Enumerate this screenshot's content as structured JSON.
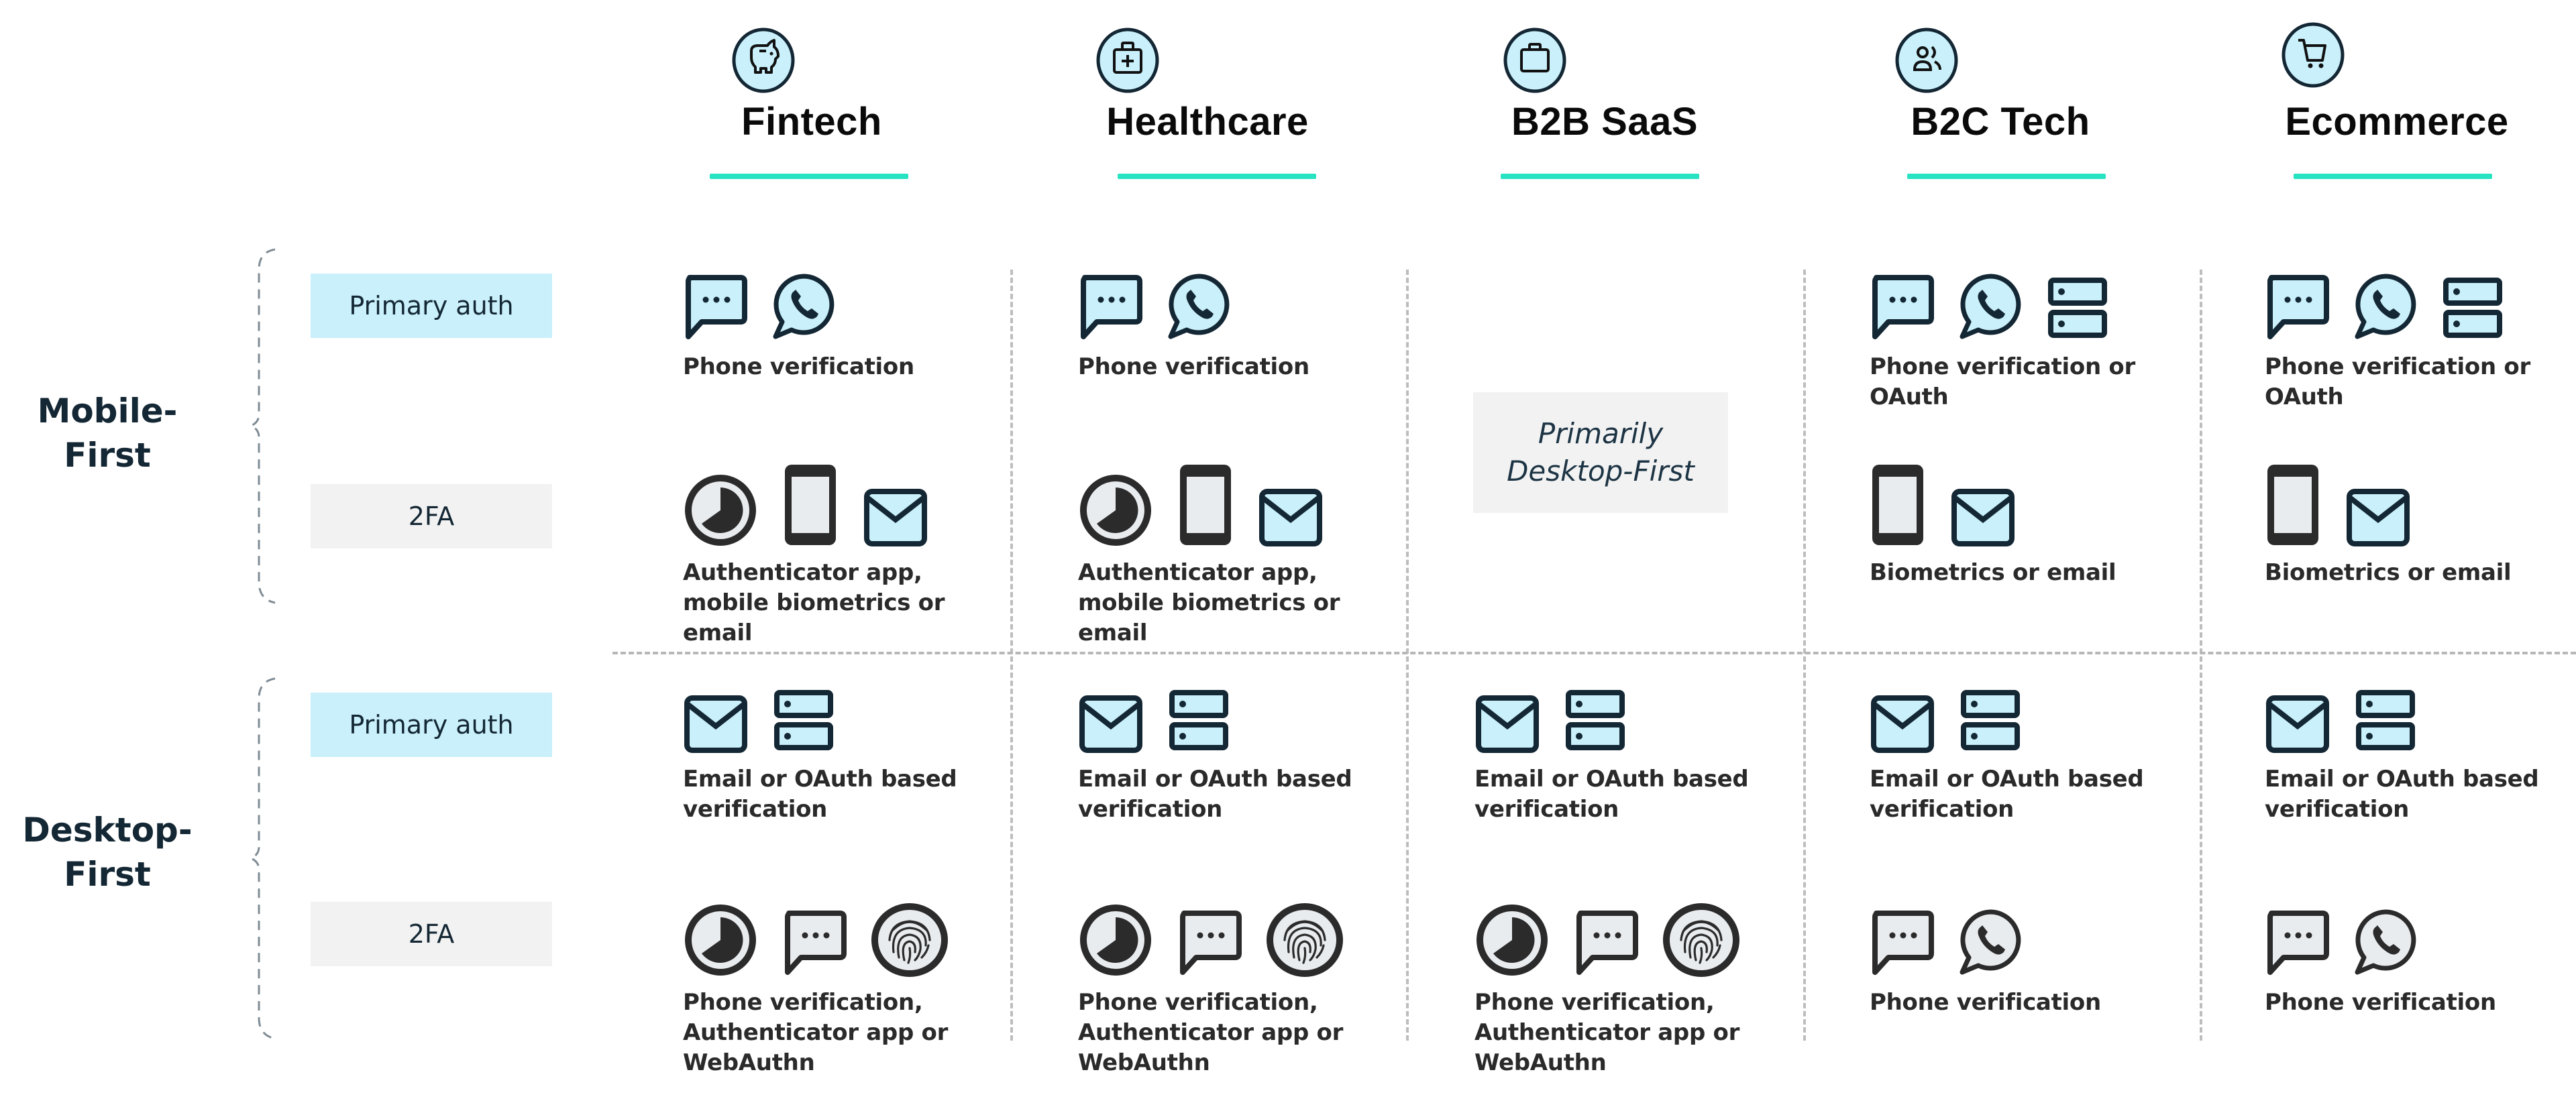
{
  "colors": {
    "accent_underline": "#27e3c2",
    "icon_fill_blue": "#c9f0fb",
    "icon_fill_gray": "#e9ecef",
    "icon_stroke_dark": "#142734",
    "primary_label_bg": "#c9f0fb",
    "twofa_label_bg": "#f2f2f2"
  },
  "columns": [
    {
      "title": "Fintech",
      "icon": "piggy-bank-icon"
    },
    {
      "title": "Healthcare",
      "icon": "medical-kit-icon"
    },
    {
      "title": "B2B SaaS",
      "icon": "briefcase-icon"
    },
    {
      "title": "B2C Tech",
      "icon": "users-icon"
    },
    {
      "title": "Ecommerce",
      "icon": "shopping-cart-icon"
    }
  ],
  "groups": [
    {
      "label_line1": "Mobile-",
      "label_line2": "First",
      "rows": [
        {
          "label": "Primary auth",
          "kind": "primary"
        },
        {
          "label": "2FA",
          "kind": "twofa"
        }
      ]
    },
    {
      "label_line1": "Desktop-",
      "label_line2": "First",
      "rows": [
        {
          "label": "Primary auth",
          "kind": "primary"
        },
        {
          "label": "2FA",
          "kind": "twofa"
        }
      ]
    }
  ],
  "b2b_mobile_note": {
    "line1": "Primarily",
    "line2": "Desktop-First"
  },
  "cells": {
    "mobile_primary": [
      {
        "text": "Phone verification",
        "icons": [
          "sms-blue",
          "whatsapp-blue"
        ]
      },
      {
        "text": "Phone verification",
        "icons": [
          "sms-blue",
          "whatsapp-blue"
        ]
      },
      null,
      {
        "text": "Phone verification or OAuth",
        "icons": [
          "sms-blue",
          "whatsapp-blue",
          "server-blue"
        ]
      },
      {
        "text": "Phone verification or OAuth",
        "icons": [
          "sms-blue",
          "whatsapp-blue",
          "server-blue"
        ]
      }
    ],
    "mobile_2fa": [
      {
        "text": "Authenticator app, mobile biometrics or email",
        "icons": [
          "timer-gray",
          "phone-gray",
          "email-blue"
        ]
      },
      {
        "text": "Authenticator app, mobile biometrics or email",
        "icons": [
          "timer-gray",
          "phone-gray",
          "email-blue"
        ]
      },
      null,
      {
        "text": "Biometrics or email",
        "icons": [
          "phone-gray",
          "email-blue"
        ]
      },
      {
        "text": "Biometrics or email",
        "icons": [
          "phone-gray",
          "email-blue"
        ]
      }
    ],
    "desktop_primary": [
      {
        "text": "Email or OAuth based verification",
        "icons": [
          "email-blue",
          "server-blue"
        ]
      },
      {
        "text": "Email or OAuth based verification",
        "icons": [
          "email-blue",
          "server-blue"
        ]
      },
      {
        "text": "Email or OAuth based verification",
        "icons": [
          "email-blue",
          "server-blue"
        ]
      },
      {
        "text": "Email or OAuth based verification",
        "icons": [
          "email-blue",
          "server-blue"
        ]
      },
      {
        "text": "Email or OAuth based verification",
        "icons": [
          "email-blue",
          "server-blue"
        ]
      }
    ],
    "desktop_2fa": [
      {
        "text": "Phone verification, Authenticator app or WebAuthn",
        "icons": [
          "timer-gray",
          "sms-gray",
          "fingerprint-gray"
        ]
      },
      {
        "text": "Phone verification, Authenticator app or WebAuthn",
        "icons": [
          "timer-gray",
          "sms-gray",
          "fingerprint-gray"
        ]
      },
      {
        "text": "Phone verification, Authenticator app or WebAuthn",
        "icons": [
          "timer-gray",
          "sms-gray",
          "fingerprint-gray"
        ]
      },
      {
        "text": "Phone verification",
        "icons": [
          "sms-gray",
          "whatsapp-gray"
        ]
      },
      {
        "text": "Phone verification",
        "icons": [
          "sms-gray",
          "whatsapp-gray"
        ]
      }
    ]
  }
}
